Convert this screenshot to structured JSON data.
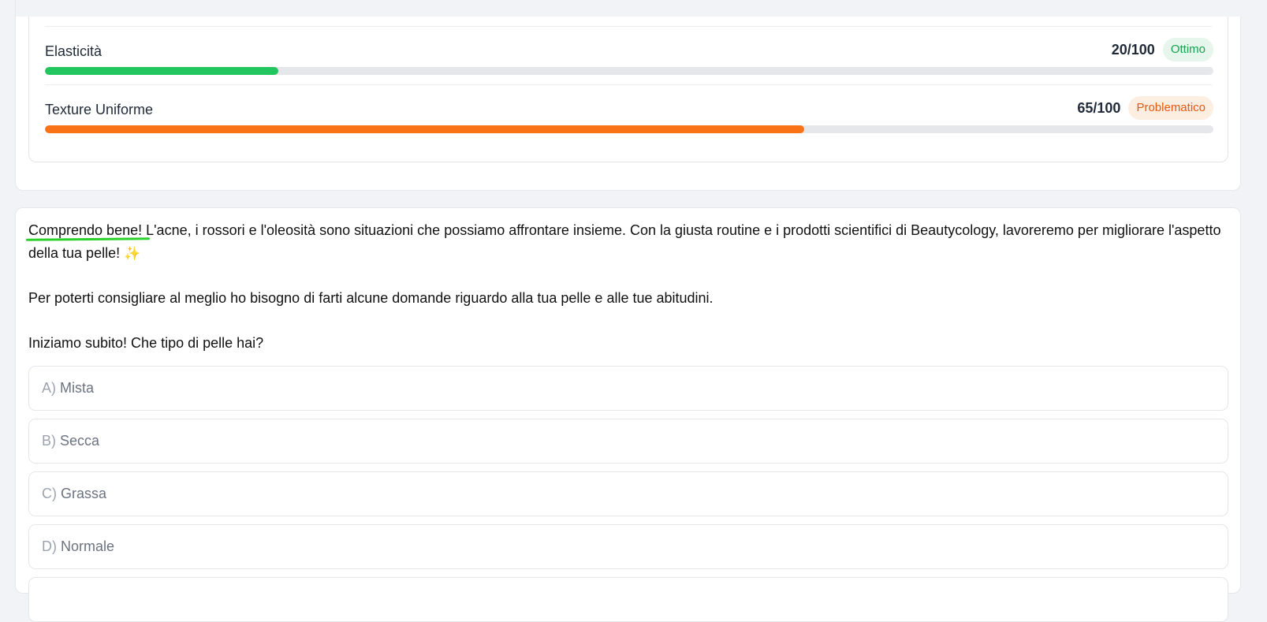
{
  "metrics": [
    {
      "label": "Elasticità",
      "score": "20/100",
      "status": "Ottimo",
      "status_kind": "good",
      "value_percent": 20,
      "bar_color": "#22c55e"
    },
    {
      "label": "Texture Uniforme",
      "score": "65/100",
      "status": "Problematico",
      "status_kind": "bad",
      "value_percent": 65,
      "bar_color": "#f97316"
    }
  ],
  "message": {
    "highlight": "Comprendo bene!",
    "paragraph1_rest": " L'acne, i rossori e l'oleosità sono situazioni che possiamo affrontare insieme. Con la giusta routine e i prodotti scientifici di Beautycology, lavoreremo per migliorare l'aspetto della tua pelle!",
    "sparkle": "✨",
    "paragraph2": "Per poterti consigliare al meglio ho bisogno di farti alcune domande riguardo alla tua pelle e alle tue abitudini.",
    "paragraph3": "Iniziamo subito! Che tipo di pelle hai?"
  },
  "options": [
    {
      "letter": "A)",
      "label": "Mista"
    },
    {
      "letter": "B)",
      "label": "Secca"
    },
    {
      "letter": "C)",
      "label": "Grassa"
    },
    {
      "letter": "D)",
      "label": "Normale"
    }
  ]
}
